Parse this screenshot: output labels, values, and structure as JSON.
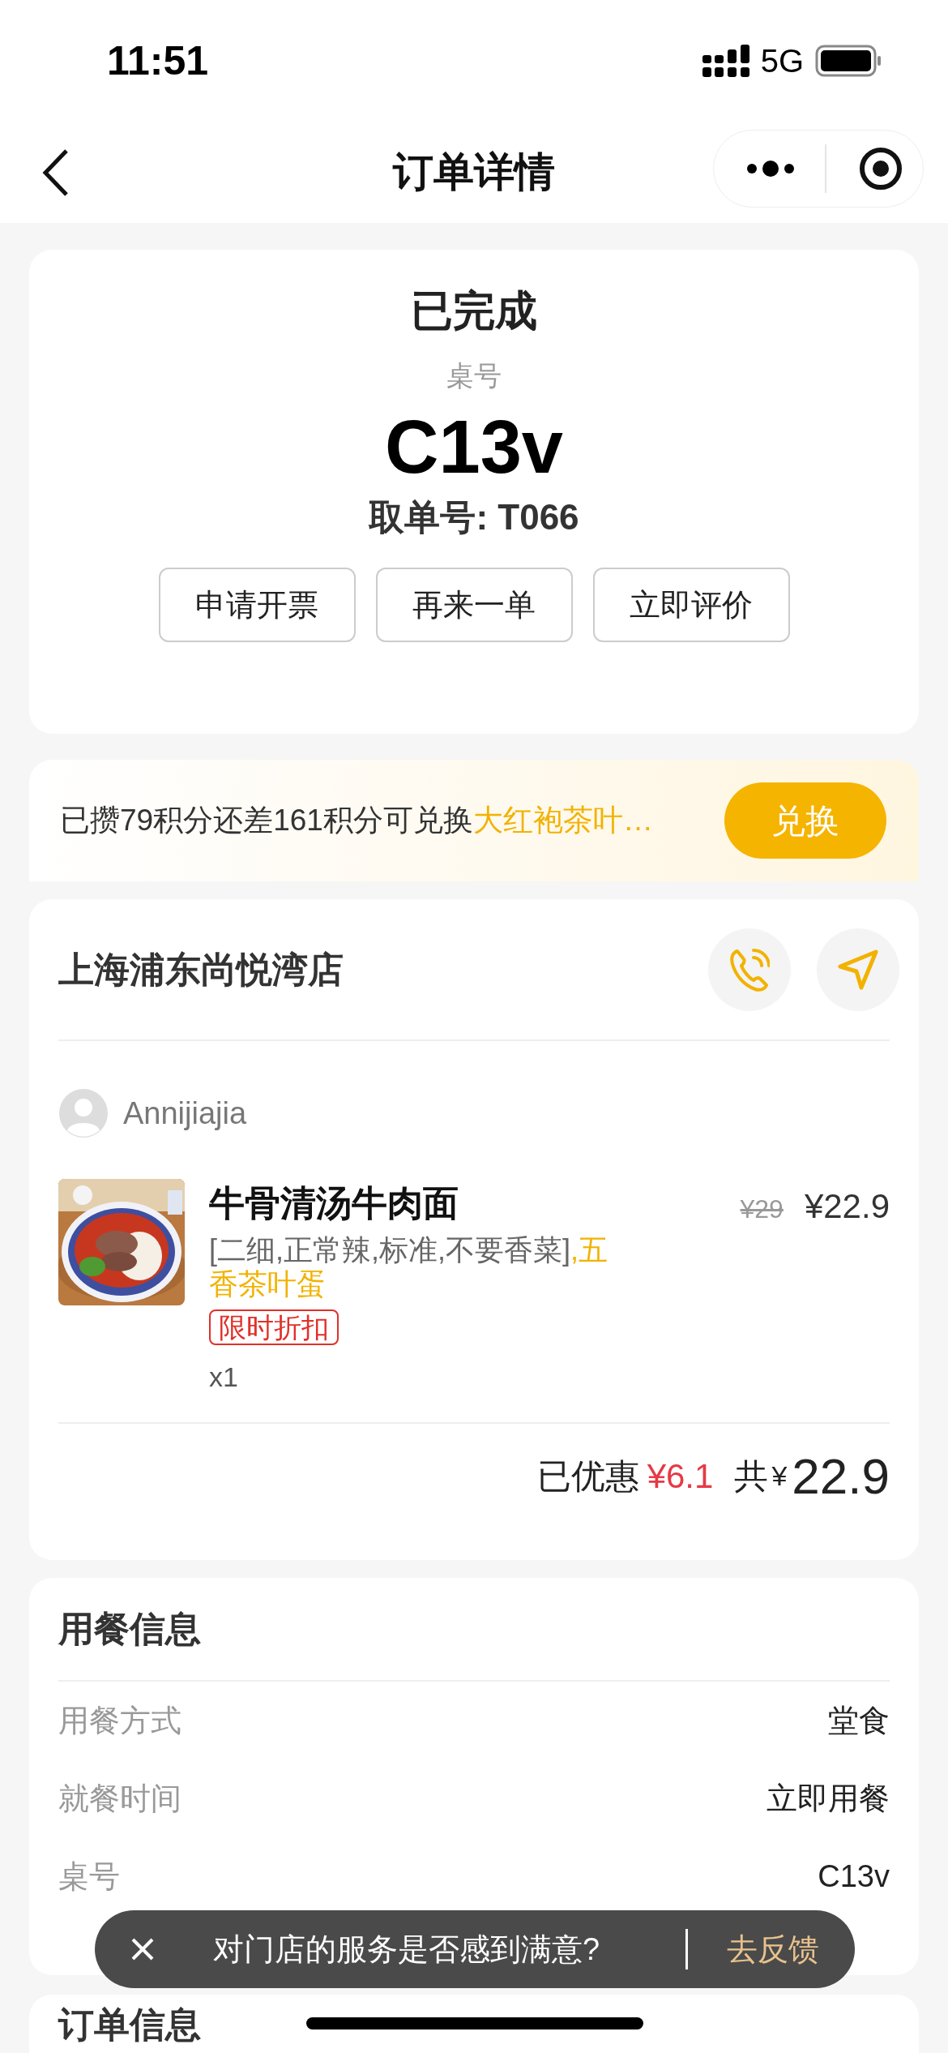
{
  "status_bar": {
    "time": "11:51",
    "network": "5G"
  },
  "nav": {
    "title": "订单详情"
  },
  "order": {
    "status": "已完成",
    "table_label": "桌号",
    "table_number": "C13v",
    "pickup": "取单号: T066",
    "actions": [
      "申请开票",
      "再来一单",
      "立即评价"
    ]
  },
  "points_banner": {
    "text": "已攒79积分还差161积分可兑换",
    "highlight": "大红袍茶叶…",
    "button": "兑换"
  },
  "store": {
    "name": "上海浦东尚悦湾店",
    "customer": "Annijiajia",
    "items": [
      {
        "name": "牛骨清汤牛肉面",
        "options": "[二细,正常辣,标准,不要香菜]",
        "extras": ",五香茶叶蛋",
        "tag": "限时折扣",
        "original_price": "¥29",
        "price": "¥22.9",
        "quantity": "x1"
      }
    ],
    "discount_label": "已优惠",
    "discount": "¥6.1",
    "total_label": "共",
    "currency": "¥",
    "total": "22.9"
  },
  "dining_info": {
    "title": "用餐信息",
    "rows": [
      {
        "label": "用餐方式",
        "value": "堂食"
      },
      {
        "label": "就餐时间",
        "value": "立即用餐"
      },
      {
        "label": "桌号",
        "value": "C13v"
      }
    ]
  },
  "toast": {
    "text": "对门店的服务是否感到满意?",
    "action": "去反馈"
  },
  "order_info": {
    "title": "订单信息"
  }
}
